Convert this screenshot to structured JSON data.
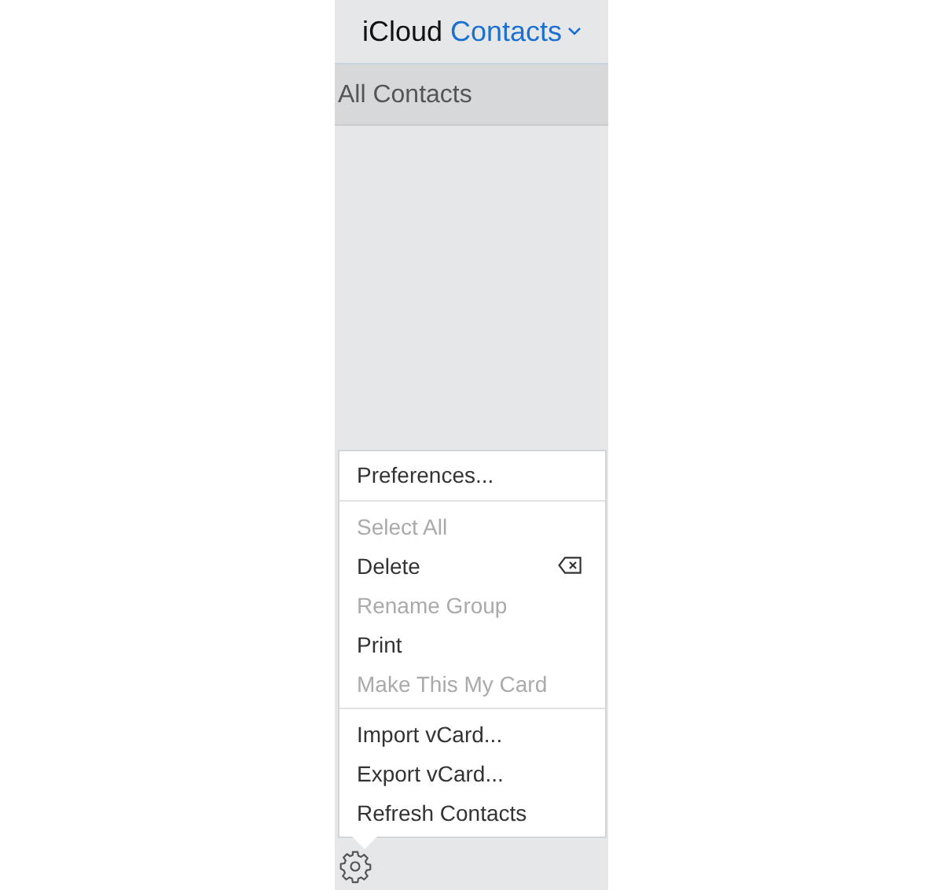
{
  "header": {
    "app": "iCloud",
    "section": "Contacts"
  },
  "groups": [
    {
      "label": "All Contacts",
      "selected": true
    }
  ],
  "menu": {
    "sections": [
      [
        {
          "label": "Preferences...",
          "disabled": false,
          "kind": "plain"
        }
      ],
      [
        {
          "label": "Select All",
          "disabled": true,
          "kind": "plain"
        },
        {
          "label": "Delete",
          "disabled": false,
          "kind": "delete-key"
        },
        {
          "label": "Rename Group",
          "disabled": true,
          "kind": "plain"
        },
        {
          "label": "Print",
          "disabled": false,
          "kind": "plain"
        },
        {
          "label": "Make This My Card",
          "disabled": true,
          "kind": "plain"
        }
      ],
      [
        {
          "label": "Import vCard...",
          "disabled": false,
          "kind": "plain"
        },
        {
          "label": "Export vCard...",
          "disabled": false,
          "kind": "plain"
        },
        {
          "label": "Refresh Contacts",
          "disabled": false,
          "kind": "plain"
        }
      ]
    ]
  }
}
